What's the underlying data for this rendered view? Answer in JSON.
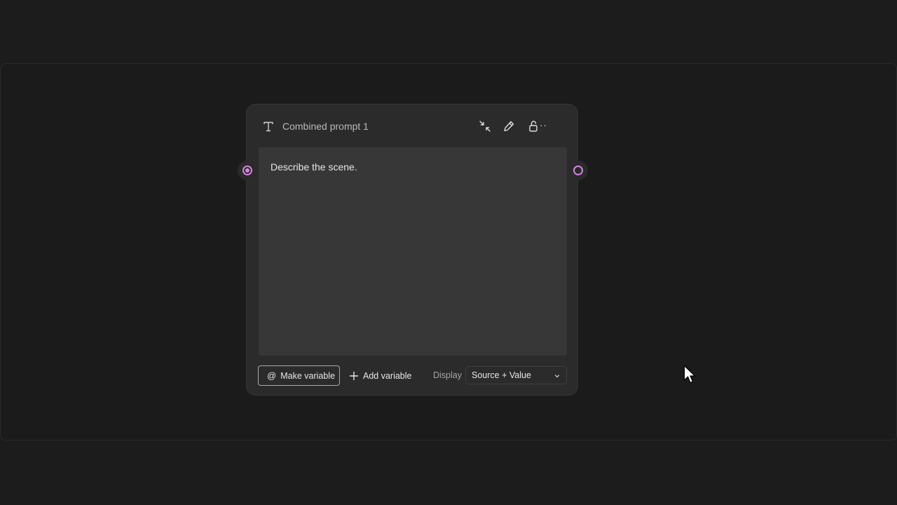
{
  "node": {
    "title": "Combined prompt 1",
    "type_icon": "text-type-icon",
    "header_icons": [
      "collapse-icon",
      "color-picker-icon",
      "unlock-icon",
      "more-icon"
    ],
    "more_label": "··",
    "prompt_text": "Describe the scene."
  },
  "footer": {
    "make_variable_label": "Make variable",
    "make_variable_icon": "@",
    "add_variable_label": "Add variable",
    "add_variable_icon": "+",
    "display_label": "Display",
    "display_value": "Source + Value"
  },
  "colors": {
    "background": "#1c1c1c",
    "node_background": "#2b2b2b",
    "editor_background": "#373737",
    "port_accent": "#d781e6"
  }
}
